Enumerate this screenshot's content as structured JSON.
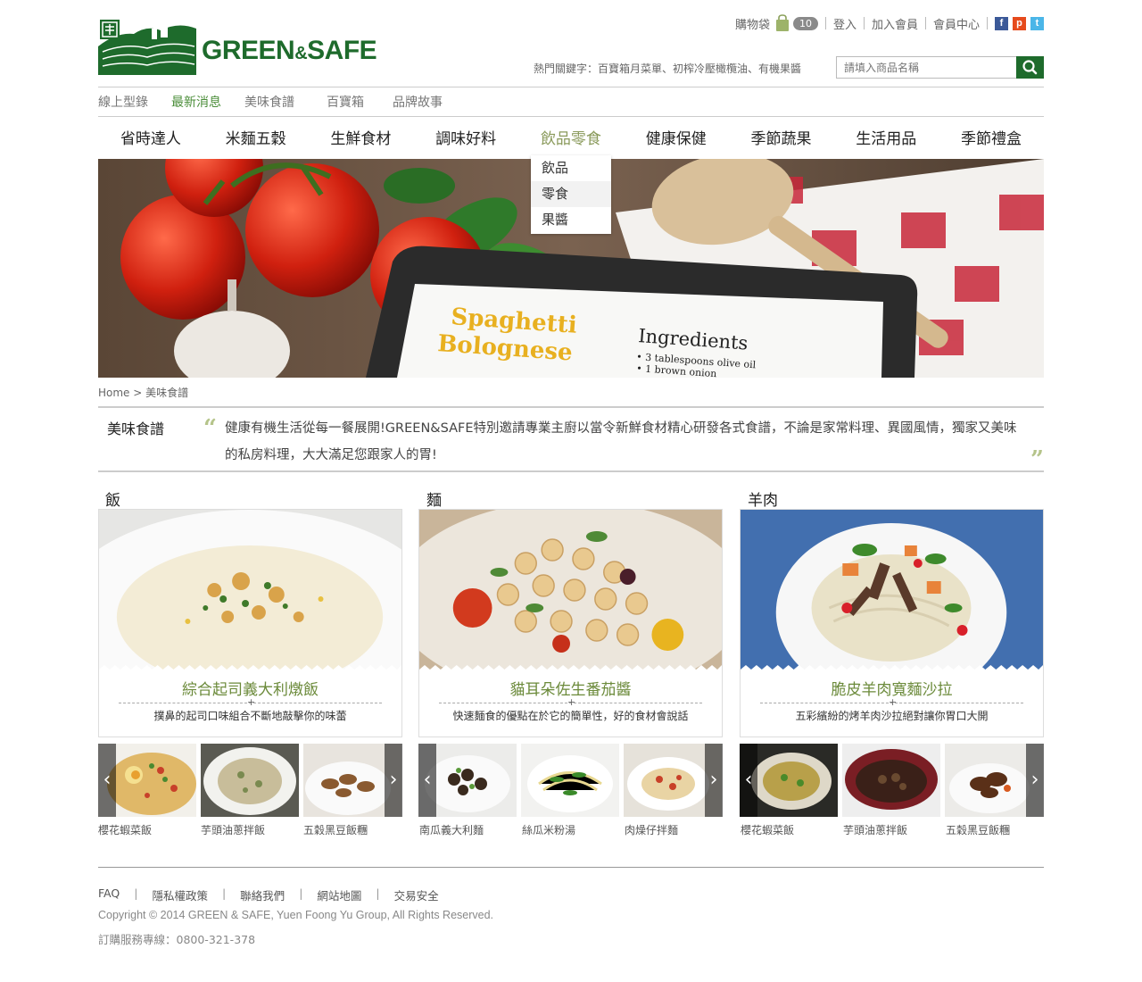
{
  "brand": {
    "name": "GREEN",
    "amp": "&",
    "name2": "SAFE"
  },
  "topnav": {
    "cart": "購物袋",
    "cart_count": "10",
    "login": "登入",
    "join": "加入會員",
    "member": "會員中心"
  },
  "hot_keywords": "熱門關鍵字：百寶箱月菜單、初榨冷壓橄欖油、有機果醬",
  "search": {
    "placeholder": "請填入商品名稱"
  },
  "subnav": [
    "線上型錄",
    "最新消息",
    "美味食譜",
    "百寶箱",
    "品牌故事"
  ],
  "mainnav": [
    "省時達人",
    "米麵五穀",
    "生鮮食材",
    "調味好料",
    "飲品零食",
    "健康保健",
    "季節蔬果",
    "生活用品",
    "季節禮盒"
  ],
  "dropdown": [
    "飲品",
    "零食",
    "果醬"
  ],
  "banner": {
    "title1": "Spaghetti",
    "title2": "Bolognese",
    "ing": "Ingredients",
    "ing1": "• 3 tablespoons olive oil",
    "ing2": "• 1 brown onion"
  },
  "breadcrumb": {
    "home": "Home",
    "sep": ">",
    "current": "美味食譜"
  },
  "intro": {
    "title": "美味食譜",
    "text": "健康有機生活從每一餐展開!GREEN&SAFE特別邀請專業主廚以當令新鮮食材精心研發各式食譜，不論是家常料理、異國風情，獨家又美味的私房料理，大大滿足您跟家人的胃!",
    "ql": "“",
    "qr": "”"
  },
  "sections": [
    {
      "title": "飯",
      "card_title": "綜合起司義大利燉飯",
      "card_sub": "撲鼻的起司口味組合不斷地敲擊你的味蕾",
      "thumbs": [
        "櫻花蝦菜飯",
        "芋頭油蔥拌飯",
        "五穀黑豆飯糰"
      ]
    },
    {
      "title": "麵",
      "card_title": "貓耳朵佐生番茄醬",
      "card_sub": "快速麵食的優點在於它的簡單性，好的食材會說話",
      "thumbs": [
        "南瓜義大利麵",
        "絲瓜米粉湯",
        "肉燥仔拌麵"
      ]
    },
    {
      "title": "羊肉",
      "card_title": "脆皮羊肉寬麵沙拉",
      "card_sub": "五彩繽紛的烤羊肉沙拉絕對讓你胃口大開",
      "thumbs": [
        "櫻花蝦菜飯",
        "芋頭油蔥拌飯",
        "五穀黑豆飯糰"
      ]
    }
  ],
  "footer": {
    "links": [
      "FAQ",
      "隱私權政策",
      "聯絡我們",
      "網站地圖",
      "交易安全"
    ],
    "copyright": "Copyright © 2014 GREEN & SAFE, Yuen Foong Yu Group, All Rights Reserved.",
    "hotline": "訂購服務專線：0800-321-378"
  },
  "colors": {
    "brand": "#1e6b2c",
    "accent": "#8a9a5b",
    "caption": "#6b8a3a"
  }
}
